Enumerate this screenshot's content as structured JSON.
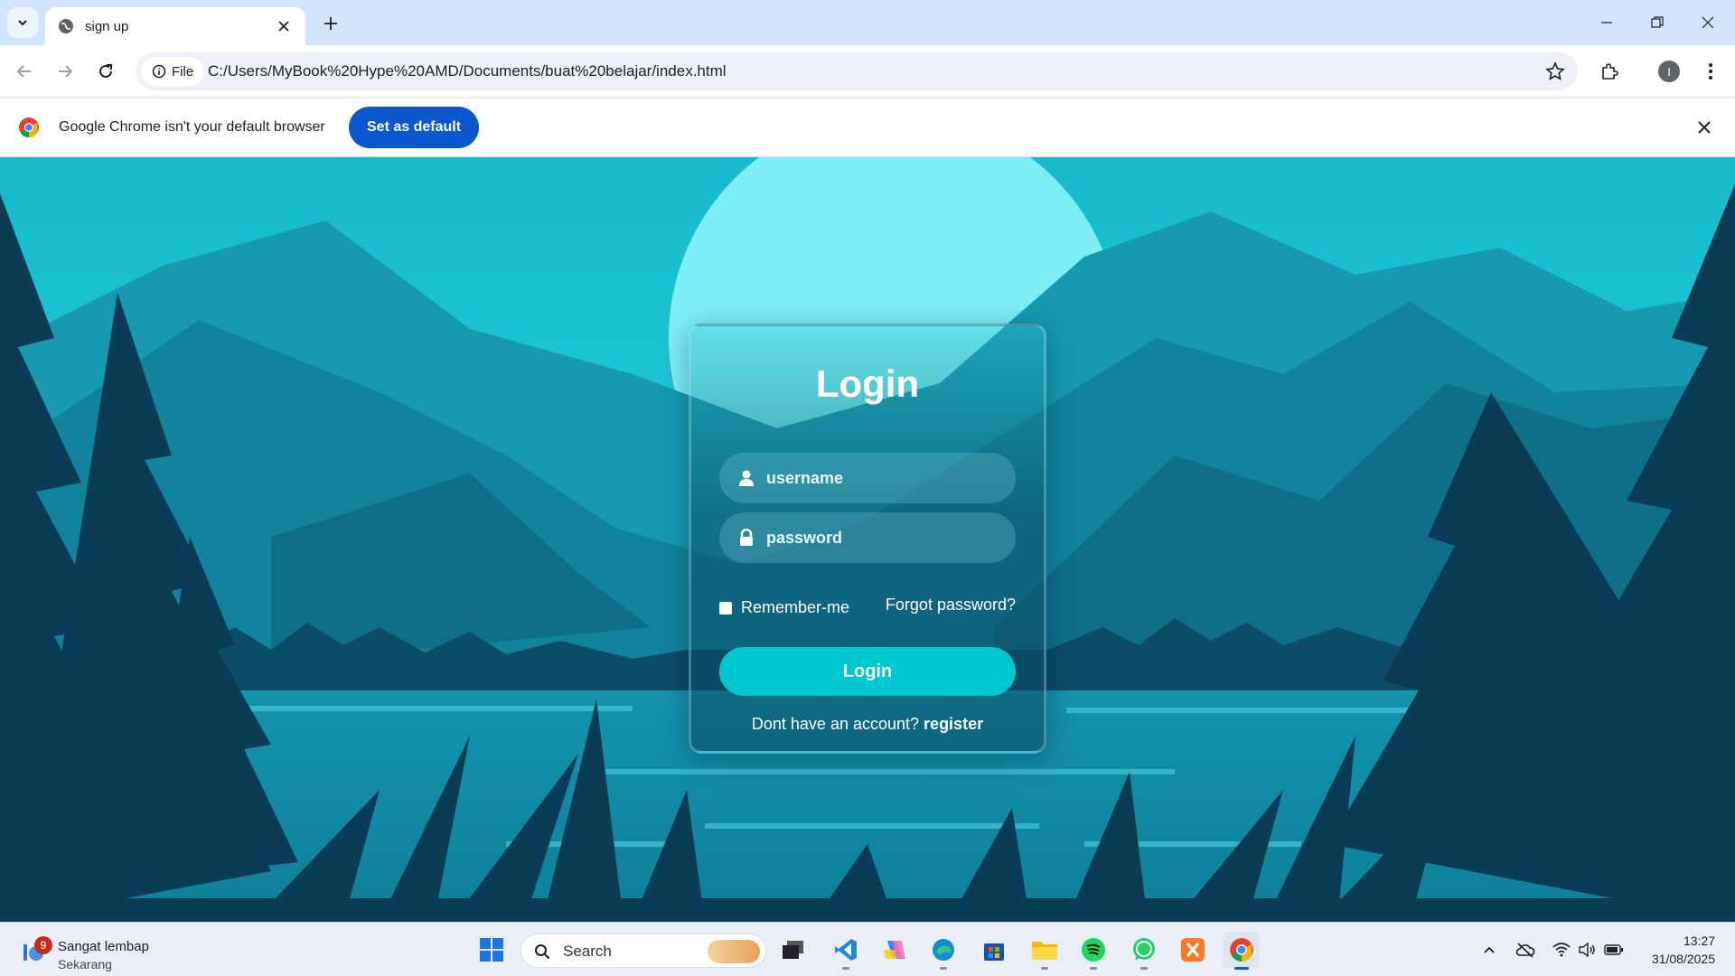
{
  "browser": {
    "tab_title": "sign up",
    "url_chip": "File",
    "url": "C:/Users/MyBook%20Hype%20AMD/Documents/buat%20belajar/index.html",
    "profile_initial": "I",
    "infobar_text": "Google Chrome isn't your default browser",
    "set_default_label": "Set as default"
  },
  "login": {
    "title": "Login",
    "username_placeholder": "username",
    "password_placeholder": "password",
    "remember_label": "Remember-me",
    "forgot_label": "Forgot password?",
    "button_label": "Login",
    "register_prompt": "Dont have an account?",
    "register_link": "register"
  },
  "taskbar": {
    "weather_badge": "9",
    "weather_title": "Sangat lembap",
    "weather_sub": "Sekarang",
    "search_label": "Search",
    "time": "13:27",
    "date": "31/08/2025",
    "apps": [
      "windows-start",
      "task-view",
      "vscode",
      "copilot",
      "edge",
      "microsoft-store",
      "file-explorer",
      "spotify",
      "whatsapp",
      "xampp",
      "chrome"
    ]
  },
  "colors": {
    "accent": "#0b57d0",
    "login_button": "#00c6d2",
    "scene_sky": "#1fc8d8",
    "scene_dark": "#0a3c55"
  }
}
